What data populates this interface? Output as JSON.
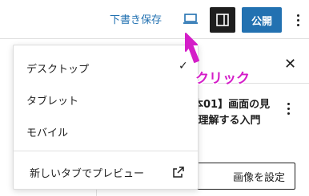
{
  "toolbar": {
    "save_draft_label": "下書き保存",
    "preview_icon": "desktop-icon",
    "settings_icon": "sidebar-icon",
    "publish_label": "公開",
    "more_icon": "more-vertical-icon"
  },
  "preview_menu": {
    "items": [
      {
        "label": "デスクトップ",
        "selected": true
      },
      {
        "label": "タブレット",
        "selected": false
      },
      {
        "label": "モバイル",
        "selected": false
      }
    ],
    "check_mark": "✓",
    "new_tab_label": "新しいタブでプレビュー",
    "new_tab_icon": "external-link-icon"
  },
  "side_panel": {
    "close_symbol": "✕",
    "post_title_line1": "本01】画面の見",
    "post_title_line2": "ｹ理解する入門",
    "featured_image_button": "画像を設定"
  },
  "annotation": {
    "text": "クリック",
    "color": "#d41ec8"
  },
  "colors": {
    "accent": "#2271b1",
    "dark": "#1e1e1e",
    "annotation": "#d41ec8"
  }
}
